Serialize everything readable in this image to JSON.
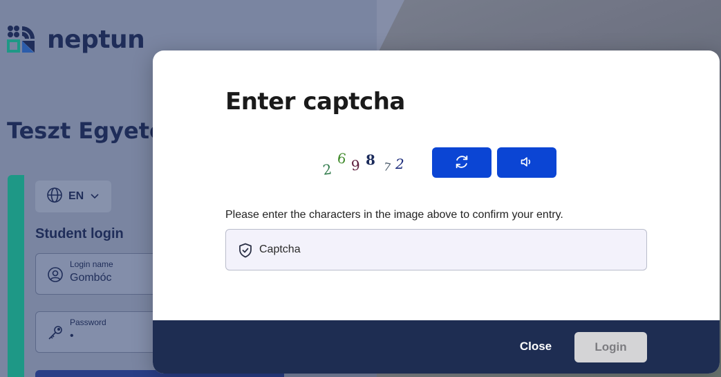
{
  "background": {
    "brand": {
      "name": "neptun"
    },
    "org_title": "Teszt Egyetem",
    "language": {
      "current": "EN"
    },
    "login_card": {
      "heading": "Student login",
      "username": {
        "label": "Login name",
        "value": "Gombóc"
      },
      "password": {
        "label": "Password",
        "value": "•"
      }
    }
  },
  "modal": {
    "title": "Enter captcha",
    "captcha_image": {
      "characters": [
        "2",
        "6",
        "9",
        "8",
        "7",
        "2"
      ],
      "colors": [
        "#2f7a4a",
        "#3f8a2a",
        "#5a1a3a",
        "#1a2a5a",
        "#4a5a6a",
        "#1a2a7a"
      ]
    },
    "refresh_icon": "refresh-icon",
    "audio_icon": "speaker-icon",
    "instructions": "Please enter the characters in the image above to confirm your entry.",
    "input": {
      "placeholder": "Captcha",
      "value": "",
      "icon": "shield-check-icon"
    },
    "footer": {
      "close_label": "Close",
      "login_label": "Login"
    }
  },
  "colors": {
    "primary": "#0b45d4",
    "footer_bg": "#1e2d52",
    "accent_teal": "#1e9e8a",
    "disabled_button": "#d4d4d6"
  }
}
